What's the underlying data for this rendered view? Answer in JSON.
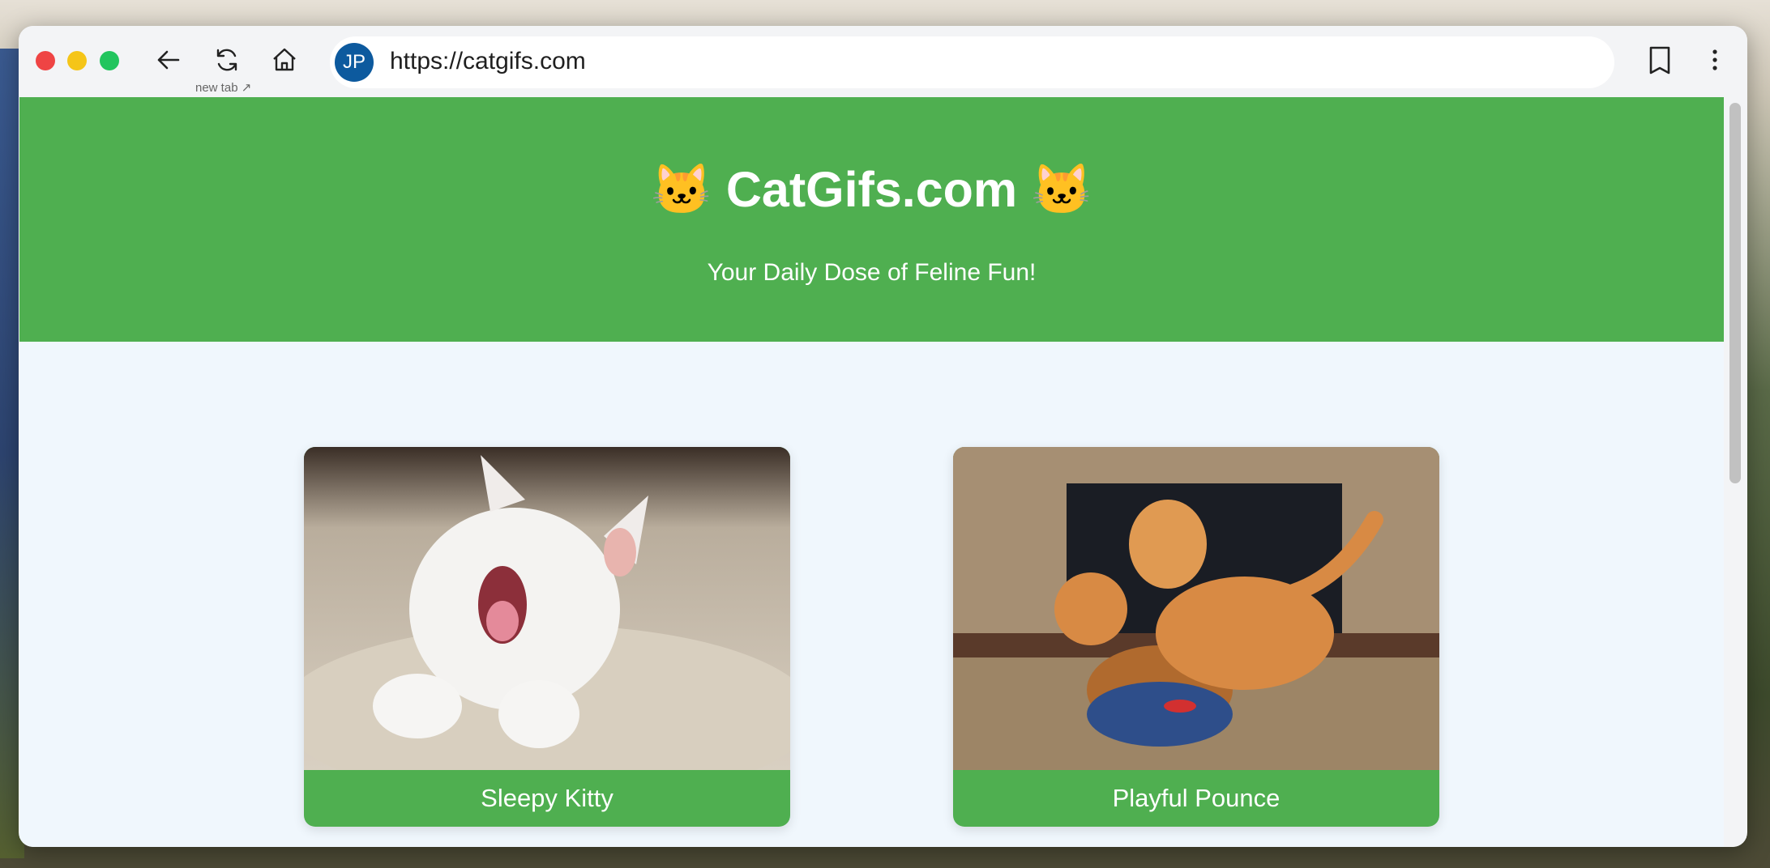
{
  "browser": {
    "url": "https://catgifs.com",
    "avatar_initials": "JP",
    "new_tab_hint": "new tab ↗",
    "icons": [
      "close-dot",
      "minimize-dot",
      "maximize-dot",
      "back-arrow-icon",
      "reload-icon",
      "home-icon",
      "bookmark-icon",
      "more-vertical-icon"
    ],
    "traffic_colors": {
      "close": "#ef4444",
      "minimize": "#f5c518",
      "maximize": "#22c55e"
    }
  },
  "header": {
    "emoji": "🐱",
    "title": "CatGifs.com",
    "subtitle": "Your Daily Dose of Feline Fun!",
    "color": "#4faf50"
  },
  "cards": [
    {
      "label": "Sleepy Kitty",
      "image": "white kitten yawning on blanket"
    },
    {
      "label": "Playful Pounce",
      "image": "two orange tabby cats with blue toy"
    }
  ]
}
